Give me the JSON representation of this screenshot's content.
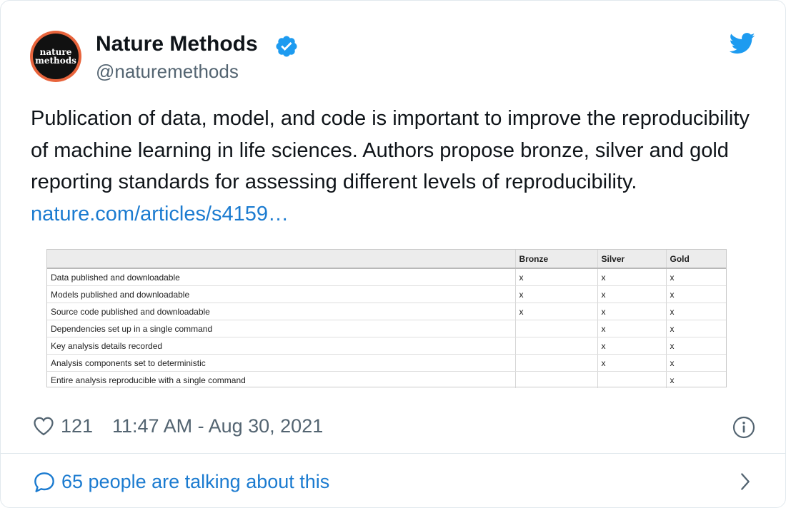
{
  "account": {
    "display_name": "Nature Methods",
    "handle": "@naturemethods",
    "avatar_text_line1": "nature",
    "avatar_text_line2": "methods"
  },
  "tweet": {
    "text": "Publication of data, model, and code is important to improve the reproducibility of machine learning in life sciences. Authors propose bronze, silver and gold reporting standards for assessing different levels of reproducibility. ",
    "link_text": "nature.com/articles/s4159…"
  },
  "table": {
    "headers": [
      "",
      "Bronze",
      "Silver",
      "Gold"
    ],
    "rows": [
      [
        "Data published and downloadable",
        "x",
        "x",
        "x"
      ],
      [
        "Models published and downloadable",
        "x",
        "x",
        "x"
      ],
      [
        "Source code published and downloadable",
        "x",
        "x",
        "x"
      ],
      [
        "Dependencies set up in a single command",
        "",
        "x",
        "x"
      ],
      [
        "Key analysis details recorded",
        "",
        "x",
        "x"
      ],
      [
        "Analysis components set to deterministic",
        "",
        "x",
        "x"
      ],
      [
        "Entire analysis reproducible with a single command",
        "",
        "",
        "x"
      ]
    ]
  },
  "footer": {
    "likes": "121",
    "timestamp": "11:47 AM - Aug 30, 2021",
    "conversation": "65 people are talking about this"
  },
  "icons": {
    "verified": "verified-badge-icon",
    "brand": "twitter-bird-icon",
    "like": "heart-icon",
    "info": "info-icon",
    "reply": "chat-bubble-icon",
    "open": "chevron-right-icon"
  },
  "colors": {
    "twitter_blue": "#1d9bf0",
    "link": "#1b7bd0",
    "muted": "#536471",
    "avatar_ring": "#e8643c"
  }
}
